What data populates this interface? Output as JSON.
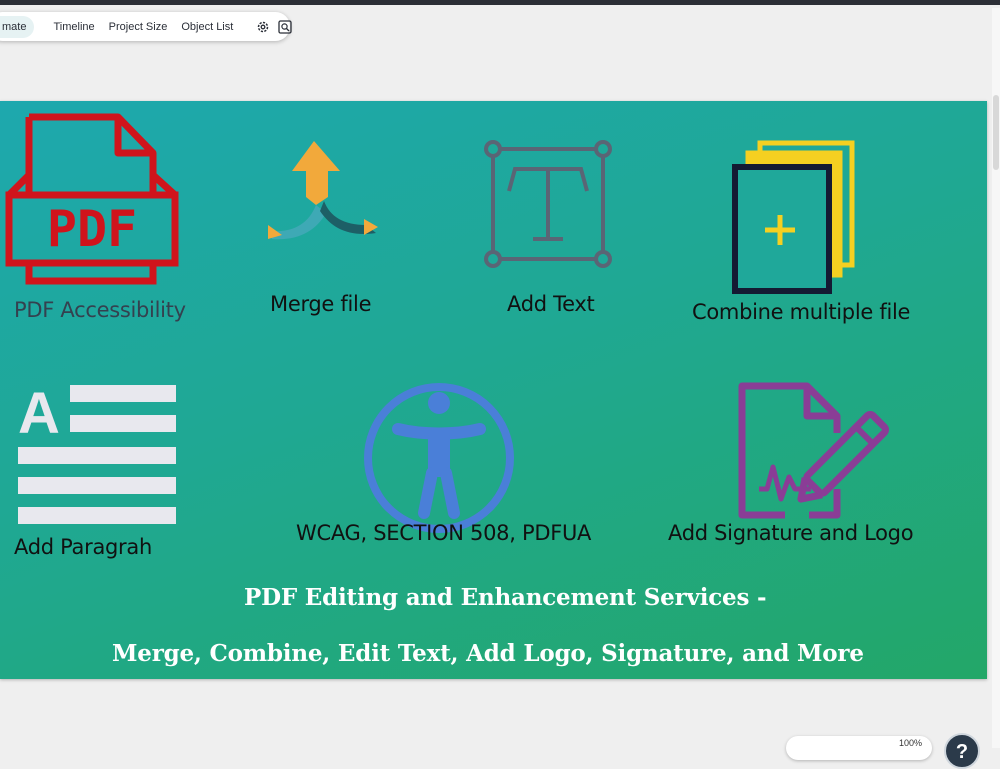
{
  "toolbar": {
    "active_tab": "mate",
    "items": [
      "Timeline",
      "Project Size",
      "Object List"
    ],
    "icons": [
      "gear-icon",
      "zoom-fit-icon"
    ]
  },
  "banner": {
    "labels": {
      "pdf_accessibility": "PDF Accessibility",
      "merge_file": "Merge file",
      "add_text": "Add Text",
      "combine_multiple_file": "Combine multiple file",
      "add_paragraph": "Add Paragrah",
      "wcag": "WCAG, SECTION 508, PDFUA",
      "add_signature": "Add Signature and Logo"
    },
    "icon_text": {
      "pdf": "PDF",
      "paragraph_letter": "A"
    },
    "headline_1": "PDF Editing and Enhancement Services -",
    "headline_2": "Merge,  Combine,  Edit Text,  Add Logo,  Signature,  and More",
    "colors": {
      "pdf_red": "#d0141c",
      "arrow_orange": "#f2a93b",
      "text_icon_gray": "#5a6575",
      "files_yellow": "#f5d021",
      "files_navy": "#141a33",
      "paragraph_white": "#e8e8ee",
      "accessibility_blue": "#4a7fd8",
      "signature_purple": "#8a3d96"
    }
  },
  "bottom": {
    "zoom_text": "100%",
    "help_label": "?"
  }
}
